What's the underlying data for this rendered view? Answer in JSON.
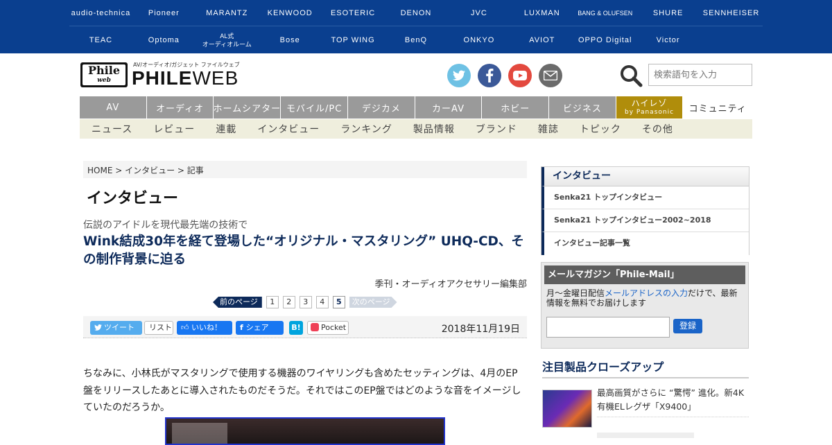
{
  "brands": {
    "row1": [
      "audio-technica",
      "Pioneer",
      "MARANTZ",
      "KENWOOD",
      "ESOTERIC",
      "DENON",
      "JVC",
      "LUXMAN",
      "BANG & OLUFSEN",
      "SHURE",
      "SENNHEISER"
    ],
    "row2": [
      "TEAC",
      "Optoma",
      "AL式\nオーディオルーム",
      "Bose",
      "TOP WING",
      "BenQ",
      "ONKYO",
      "AVIOT",
      "OPPO Digital",
      "Victor"
    ]
  },
  "logo": {
    "badge_top": "Phile",
    "badge_bottom": "web",
    "tagline": "AV/オーディオ/ガジェット ファイルウェブ",
    "word_bold": "PHILE",
    "word_light": "WEB"
  },
  "social_icons": [
    "twitter-icon",
    "facebook-icon",
    "youtube-icon",
    "mail-icon"
  ],
  "search": {
    "placeholder": "検索語句を入力"
  },
  "main_nav": {
    "items": [
      "AV",
      "オーディオ",
      "ホームシアター",
      "モバイル/PC",
      "デジカメ",
      "カーAV",
      "ホビー",
      "ビジネス"
    ],
    "hires_label": "ハイレゾ",
    "hires_sub": "by Panasonic",
    "community": "コミュニティ"
  },
  "sub_nav": [
    "ニュース",
    "レビュー",
    "連載",
    "インタビュー",
    "ランキング",
    "製品情報",
    "ブランド",
    "雑誌",
    "トピック",
    "その他"
  ],
  "breadcrumb": {
    "home": "HOME",
    "sep1": " > ",
    "section": "インタビュー",
    "sep2": " > ",
    "current": "記事"
  },
  "article": {
    "section_title": "インタビュー",
    "subtitle": "伝説のアイドルを現代最先端の技術で",
    "headline": "Wink結成30年を経て登場した“オリジナル・マスタリング” UHQ-CD、その制作背景に迫る",
    "byline": "季刊・オーディオアクセサリー編集部",
    "date": "2018年11月19日",
    "body": "ちなみに、小林氏がマスタリングで使用する機器のワイヤリングも含めたセッティングは、4月のEP盤をリリースしたあとに導入されたものだそうだ。それではこのEP盤ではどのような音をイメージしていたのだろうか。"
  },
  "pager": {
    "prev": "前のページ",
    "pages": [
      "1",
      "2",
      "3",
      "4",
      "5"
    ],
    "current": "5",
    "next": "次のページ"
  },
  "share": {
    "tweet": "ツイート",
    "list": "リスト",
    "like": "いいね！",
    "share": "シェア",
    "hatena": "B!",
    "pocket": "Pocket"
  },
  "sidebar": {
    "interview": {
      "title": "インタビュー",
      "links": [
        "Senka21 トップインタビュー",
        "Senka21 トップインタビュー2002~2018",
        "インタビュー記事一覧"
      ]
    },
    "mail": {
      "title": "メールマガジン「Phile-Mail」",
      "desc_pre": "月～金曜日配信",
      "desc_link": "メールアドレスの入力",
      "desc_post": "だけで、最新情報を無料でお届けします",
      "button": "登録"
    },
    "featured": {
      "title": "注目製品クローズアップ",
      "item_text": "最高画質がさらに “驚愕” 進化。新4K有機ELレグザ「X9400」"
    }
  },
  "colors": {
    "brand_bar": "#0a3f8f",
    "nav_gray": "#9a9a9a",
    "hires_gold": "#b08d0b",
    "subnav_bg": "#efeedd",
    "headline_navy": "#0d2a5a",
    "link_blue": "#1a64c8"
  }
}
